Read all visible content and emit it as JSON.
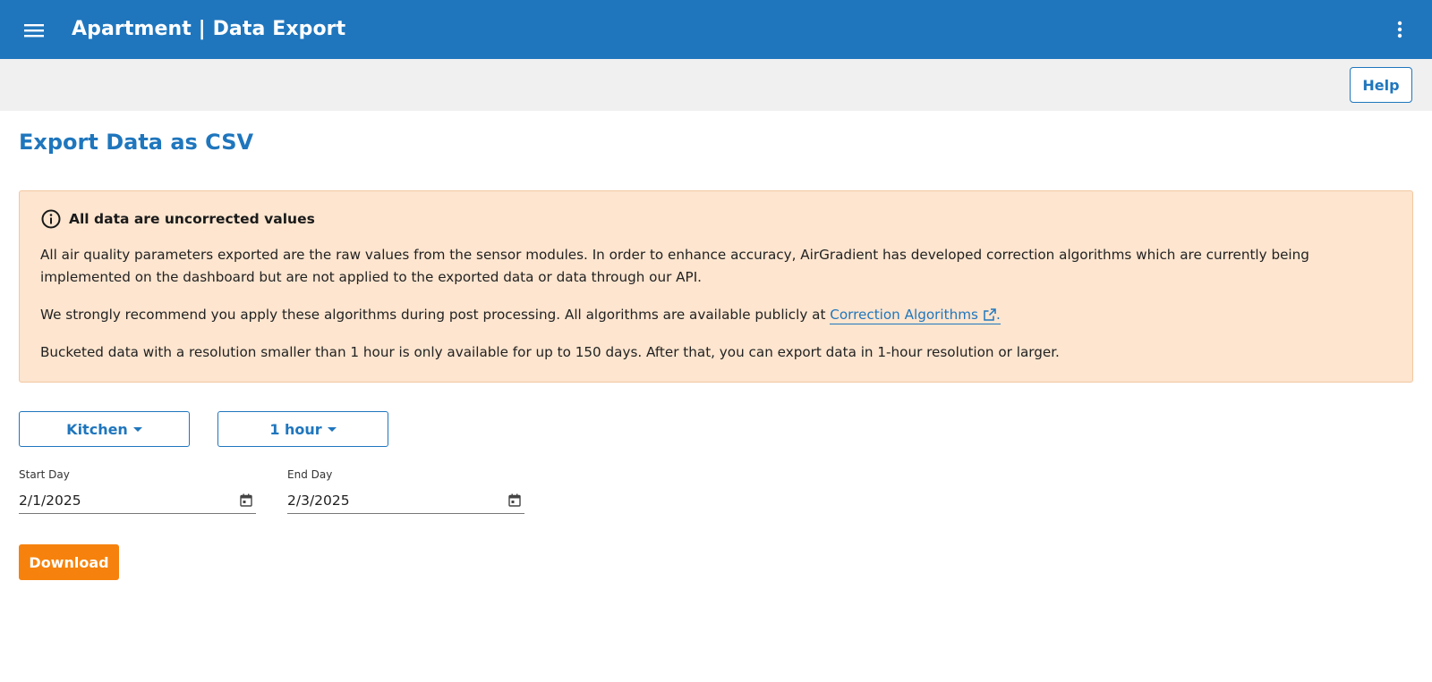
{
  "header": {
    "title": "Apartment | Data Export",
    "menu_icon": "hamburger-menu-icon",
    "more_icon": "more-vertical-icon",
    "color": "#1f76bd"
  },
  "toolbar": {
    "help_label": "Help"
  },
  "page": {
    "title": "Export Data as CSV"
  },
  "notice": {
    "title": "All data are uncorrected values",
    "icon": "info-icon",
    "paragraph1": "All air quality parameters exported are the raw values from the sensor modules. In order to enhance accuracy, AirGradient has developed correction algorithms which are currently being implemented on the dashboard but are not applied to the exported data or data through our API.",
    "paragraph2_prefix": "We strongly recommend you apply these algorithms during post processing. All algorithms are available publicly at ",
    "link_label": "Correction Algorithms",
    "paragraph2_suffix": ".",
    "paragraph3": "Bucketed data with a resolution smaller than 1 hour is only available for up to 150 days. After that, you can export data in 1-hour resolution or larger.",
    "background": "#fde5cf"
  },
  "filters": {
    "location_selected": "Kitchen",
    "resolution_selected": "1 hour"
  },
  "dates": {
    "start_label": "Start Day",
    "start_value": "2/1/2025",
    "end_label": "End Day",
    "end_value": "2/3/2025"
  },
  "actions": {
    "download_label": "Download",
    "download_color": "#f6820d"
  }
}
